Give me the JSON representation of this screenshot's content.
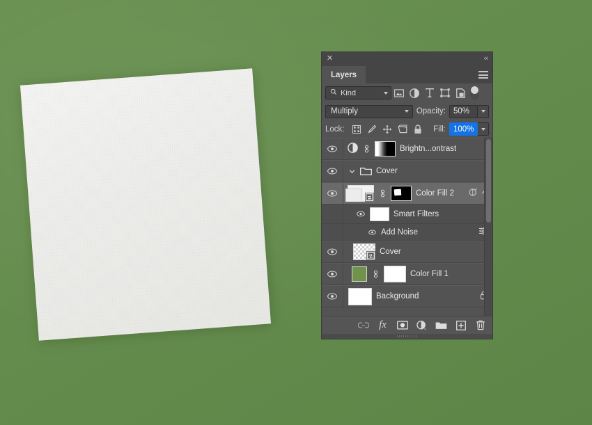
{
  "background": {
    "color": "#648c4c",
    "paper_color": "#efefec"
  },
  "panel": {
    "title": "Layers",
    "close_glyph": "✕",
    "collapse_glyph": "‹‹",
    "menu_name": "panel-menu"
  },
  "filter_row": {
    "kind_label": "Kind",
    "search_icon": "search-icon",
    "icons": [
      {
        "name": "filter-pixel-icon",
        "title": "Pixel layers"
      },
      {
        "name": "filter-adjustment-icon",
        "title": "Adjustment layers"
      },
      {
        "name": "filter-type-icon",
        "title": "Type layers"
      },
      {
        "name": "filter-shape-icon",
        "title": "Shape layers"
      },
      {
        "name": "filter-smartobject-icon",
        "title": "Smart objects"
      }
    ],
    "toggle_name": "filter-enable-toggle"
  },
  "blend_row": {
    "blend_mode": "Multiply",
    "opacity_label": "Opacity:",
    "opacity_value": "50%"
  },
  "lock_row": {
    "lock_label": "Lock:",
    "lock_icons": [
      {
        "name": "lock-transparent-pixels-icon"
      },
      {
        "name": "lock-image-pixels-icon"
      },
      {
        "name": "lock-position-icon"
      },
      {
        "name": "lock-artboard-nesting-icon"
      },
      {
        "name": "lock-all-icon"
      }
    ],
    "fill_label": "Fill:",
    "fill_value": "100%",
    "fill_selected": true,
    "fill_highlight_color": "#1473e6"
  },
  "layers": [
    {
      "id": "brightness-contrast",
      "name": "Brightn...ontrast",
      "visible": true,
      "selected": false,
      "type": "adjustment",
      "has_link": true,
      "thumb": "adjustment-halfcircle-icon",
      "mask": "gradient-mask"
    },
    {
      "id": "cover-group",
      "name": "Cover",
      "visible": true,
      "selected": false,
      "type": "group",
      "expanded": true,
      "thumb": "folder-icon"
    },
    {
      "id": "color-fill-2",
      "name": "Color Fill 2",
      "visible": true,
      "selected": true,
      "type": "smart-object",
      "has_link": true,
      "mask": "black-white-mask",
      "right_icons": [
        "smart-filter-icon",
        "chevron-up-icon"
      ]
    },
    {
      "id": "smart-filters",
      "name": "Smart Filters",
      "visible": true,
      "selected": false,
      "type": "smart-filters-header",
      "thumb": "white-thumb"
    },
    {
      "id": "add-noise",
      "name": "Add Noise",
      "visible": true,
      "selected": false,
      "type": "smart-filter-entry",
      "right_icons": [
        "filter-settings-icon"
      ]
    },
    {
      "id": "cover-layer",
      "name": "Cover",
      "visible": true,
      "selected": false,
      "type": "smart-object",
      "thumb": "checker-thumb"
    },
    {
      "id": "color-fill-1",
      "name": "Color Fill 1",
      "visible": true,
      "selected": false,
      "type": "fill",
      "has_link": true,
      "thumb_color": "#70924a",
      "mask": "white-mask"
    },
    {
      "id": "background",
      "name": "Background",
      "visible": true,
      "selected": false,
      "type": "background",
      "thumb": "white-thumb",
      "locked": true,
      "right_icons": [
        "lock-icon"
      ]
    }
  ],
  "bottom_bar": {
    "buttons": [
      {
        "name": "link-layers-button",
        "label": "Link layers"
      },
      {
        "name": "layer-style-button",
        "label": "fx"
      },
      {
        "name": "add-layer-mask-button",
        "label": "Add layer mask"
      },
      {
        "name": "new-adjustment-layer-button",
        "label": "New fill or adjustment layer"
      },
      {
        "name": "new-group-button",
        "label": "New group"
      },
      {
        "name": "new-layer-button",
        "label": "New layer"
      },
      {
        "name": "delete-layer-button",
        "label": "Delete layer"
      }
    ]
  }
}
